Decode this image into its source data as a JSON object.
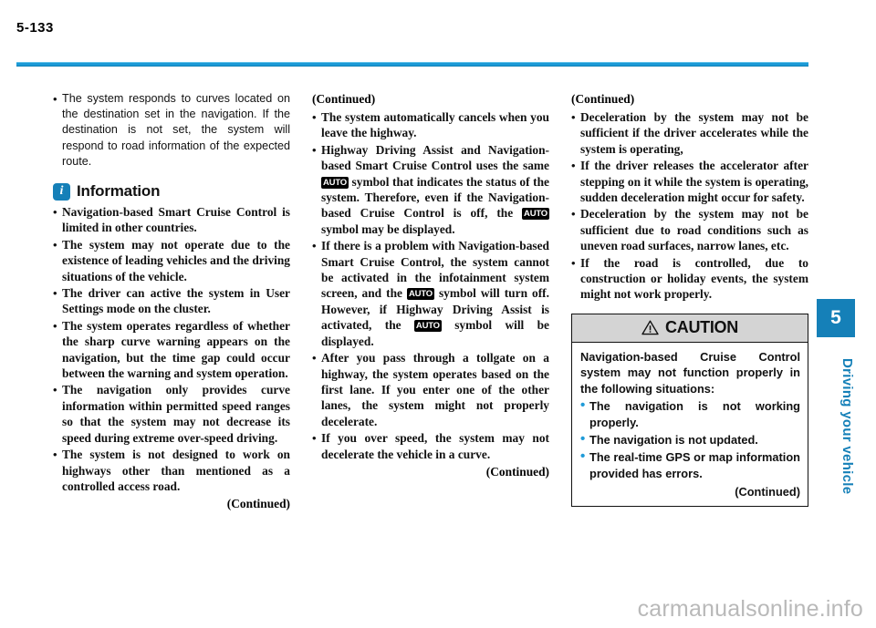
{
  "page": {
    "number": "5-133",
    "chapter_number": "5",
    "chapter_label": "Driving your vehicle",
    "accent_color": "#1580b8",
    "watermark": "carmanualsonline.info"
  },
  "column1": {
    "lead_bullet": "The system responds to curves located on the destination set in the navigation. If the destination is not set, the system will respond to road information of the expected route.",
    "info_heading": "Information",
    "info_icon": "information-icon",
    "info_bullets": [
      "Navigation-based Smart Cruise Control is limited in other countries.",
      "The system may not operate due to the existence of leading vehicles and the driving situations of the vehicle.",
      "The driver can active the system in User Settings mode on the cluster.",
      "The system operates regardless of whether the sharp curve warning appears on the navigation, but the time gap could occur between the warning and system operation.",
      "The navigation only provides curve information within permitted speed ranges so that the system may not decrease its speed during extreme over-speed driving.",
      "The system is not designed to work on highways other than mentioned as a controlled access road."
    ],
    "continued": "(Continued)"
  },
  "column2": {
    "continued_head": "(Continued)",
    "bullets": [
      {
        "parts": [
          {
            "type": "text",
            "value": "The system automatically cancels when you leave the highway."
          }
        ]
      },
      {
        "parts": [
          {
            "type": "text",
            "value": "Highway Driving Assist and Navigation-based Smart Cruise Control uses the same "
          },
          {
            "type": "chip",
            "value": "AUTO"
          },
          {
            "type": "text",
            "value": " symbol that indicates the status of the system. Therefore, even if the Navigation-based Cruise Control is off, the "
          },
          {
            "type": "chip",
            "value": "AUTO"
          },
          {
            "type": "text",
            "value": " symbol may be displayed."
          }
        ]
      },
      {
        "parts": [
          {
            "type": "text",
            "value": "If there is a problem with Navigation-based Smart Cruise Control, the system cannot be activated in the infotainment system screen, and the "
          },
          {
            "type": "chip",
            "value": "AUTO"
          },
          {
            "type": "text",
            "value": " symbol will turn off. However, if Highway Driving Assist is activated, the "
          },
          {
            "type": "chip",
            "value": "AUTO"
          },
          {
            "type": "text",
            "value": " symbol will be displayed."
          }
        ]
      },
      {
        "parts": [
          {
            "type": "text",
            "value": "After you pass through a tollgate on a highway, the system operates based on the first lane. If you enter one of the other lanes, the system might not properly decelerate."
          }
        ]
      },
      {
        "parts": [
          {
            "type": "text",
            "value": "If you over speed, the system may not decelerate the vehicle in a curve."
          }
        ]
      }
    ],
    "continued": "(Continued)"
  },
  "column3": {
    "continued_head": "(Continued)",
    "bullets": [
      "Deceleration by the system may not be sufficient if the driver accelerates while the system is operating,",
      "If the driver releases the accelerator after stepping on it while the system is operating, sudden deceleration might occur for safety.",
      "Deceleration by the system may not be sufficient due to road conditions such as uneven road surfaces, narrow lanes, etc.",
      "If the road is controlled, due to construction or holiday events, the system might not work properly."
    ],
    "caution": {
      "title": "CAUTION",
      "icon": "warning-triangle-icon",
      "intro": "Navigation-based Cruise Control system may not function properly in the following situations:",
      "bullets": [
        "The navigation is not working properly.",
        "The navigation is not updated.",
        "The real-time GPS or map information provided has errors."
      ],
      "continued": "(Continued)",
      "bullet_color": "#1f9bd8"
    }
  }
}
